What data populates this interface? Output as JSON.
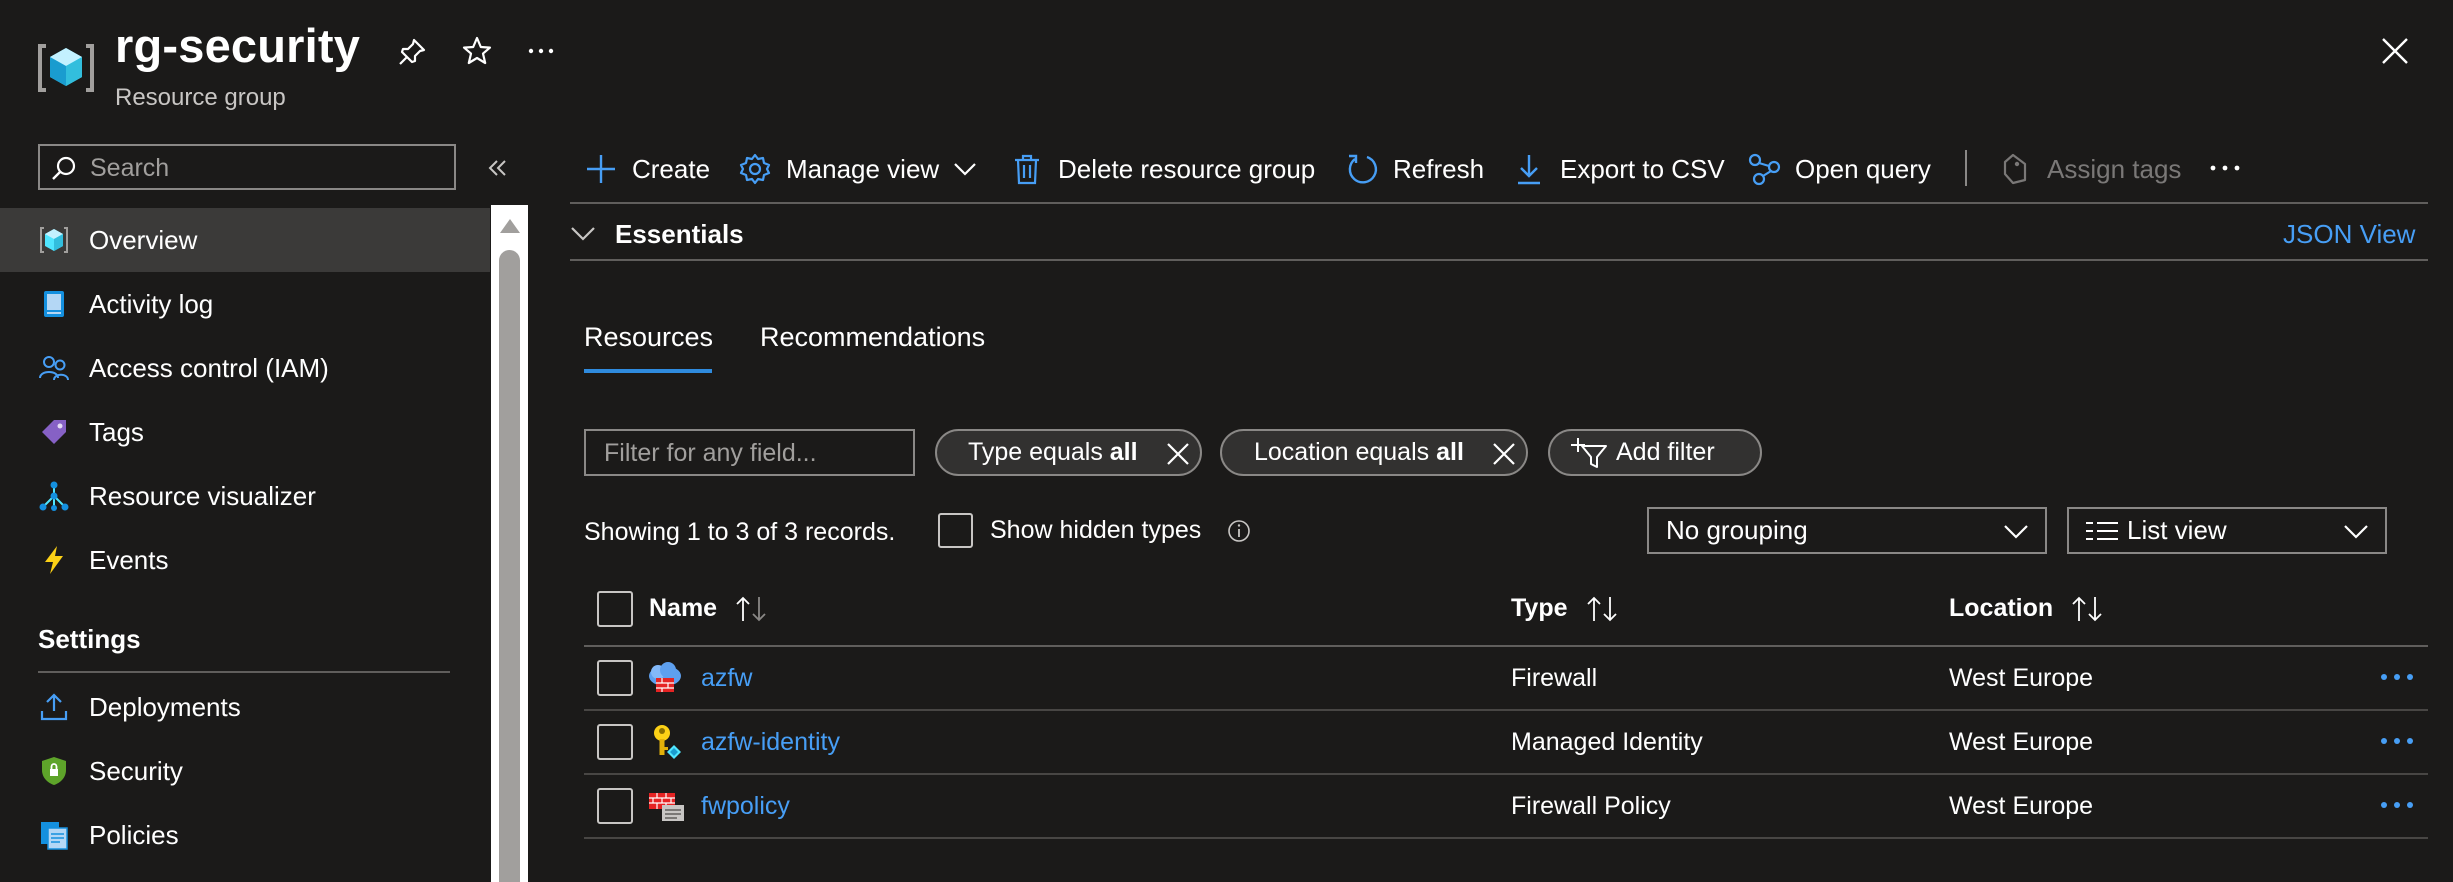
{
  "header": {
    "title": "rg-security",
    "subtitle": "Resource group"
  },
  "search": {
    "placeholder": "Search"
  },
  "sidebar": {
    "items": [
      {
        "label": "Overview",
        "icon": "resource-group-icon"
      },
      {
        "label": "Activity log",
        "icon": "activity-log-icon"
      },
      {
        "label": "Access control (IAM)",
        "icon": "iam-people-icon"
      },
      {
        "label": "Tags",
        "icon": "tag-icon"
      },
      {
        "label": "Resource visualizer",
        "icon": "visualizer-icon"
      },
      {
        "label": "Events",
        "icon": "lightning-icon"
      }
    ],
    "settings_title": "Settings",
    "settings_items": [
      {
        "label": "Deployments",
        "icon": "upload-icon"
      },
      {
        "label": "Security",
        "icon": "shield-icon"
      },
      {
        "label": "Policies",
        "icon": "policy-icon"
      }
    ]
  },
  "toolbar": {
    "create": "Create",
    "manage_view": "Manage view",
    "delete": "Delete resource group",
    "refresh": "Refresh",
    "export": "Export to CSV",
    "open_query": "Open query",
    "assign_tags": "Assign tags"
  },
  "essentials": {
    "label": "Essentials",
    "json_view": "JSON View"
  },
  "tabs": [
    {
      "label": "Resources",
      "active": true
    },
    {
      "label": "Recommendations",
      "active": false
    }
  ],
  "filters": {
    "placeholder": "Filter for any field...",
    "type_pill": {
      "prefix": "Type equals ",
      "value": "all"
    },
    "location_pill": {
      "prefix": "Location equals ",
      "value": "all"
    },
    "add_filter": "Add filter"
  },
  "records": {
    "showing": "Showing 1 to 3 of 3 records.",
    "show_hidden": "Show hidden types"
  },
  "grouping": {
    "selected": "No grouping"
  },
  "view": {
    "selected": "List view"
  },
  "table": {
    "columns": [
      "Name",
      "Type",
      "Location"
    ],
    "rows": [
      {
        "name": "azfw",
        "type": "Firewall",
        "location": "West Europe",
        "icon": "firewall-icon"
      },
      {
        "name": "azfw-identity",
        "type": "Managed Identity",
        "location": "West Europe",
        "icon": "managed-identity-icon"
      },
      {
        "name": "fwpolicy",
        "type": "Firewall Policy",
        "location": "West Europe",
        "icon": "firewall-policy-icon"
      }
    ]
  },
  "colors": {
    "background": "#1b1a19",
    "accent": "#479ef5",
    "active_nav": "#3b3a39",
    "tab_underline": "#2f8bde"
  }
}
